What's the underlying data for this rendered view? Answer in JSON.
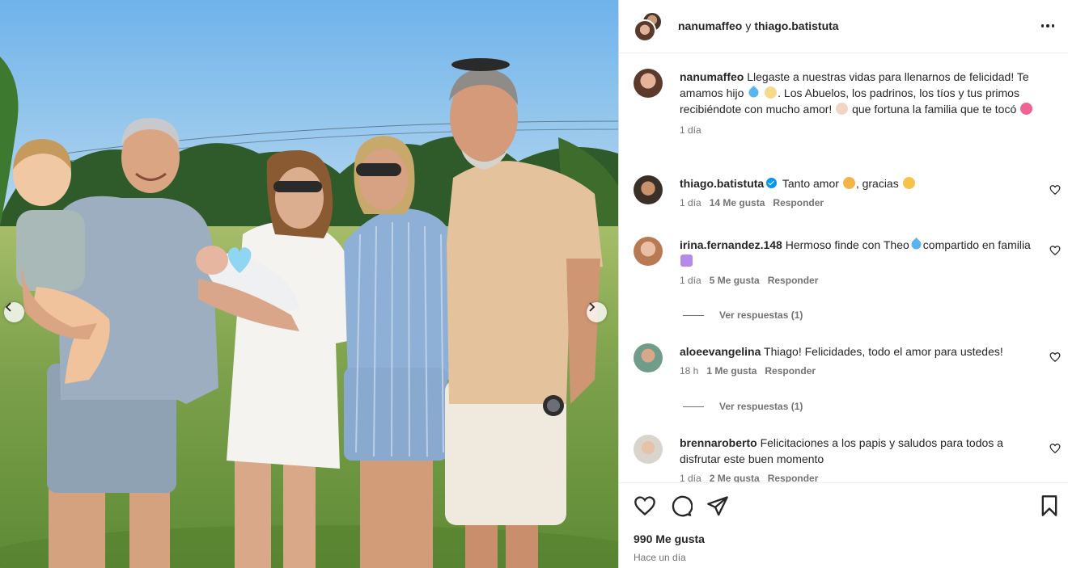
{
  "post": {
    "author": "nanumaffeo",
    "joiner": "y",
    "coauthor": "thiago.batistuta",
    "caption_user": "nanumaffeo",
    "caption_text_1": "Llegaste a nuestras vidas para llenarnos de felicidad! Te amamos hijo",
    "caption_text_2": ". Los Abuelos, los padrinos, los tíos y tus primos recibiéndote con mucho amor!",
    "caption_text_3": "que fortuna la familia que te tocó",
    "caption_time": "1 día",
    "likes": "990 Me gusta",
    "posted": "Hace un día"
  },
  "comments": [
    {
      "user": "thiago.batistuta",
      "text_1": "Tanto amor",
      "text_2": ", gracias",
      "time": "1 día",
      "likes": "14 Me gusta",
      "reply": "Responder"
    },
    {
      "user": "irina.fernandez.148",
      "text_1": "Hermoso finde con Theo",
      "text_2": "compartido en familia",
      "time": "1 día",
      "likes": "5 Me gusta",
      "reply": "Responder",
      "view_replies": "Ver respuestas (1)"
    },
    {
      "user": "aloeevangelina",
      "text_1": "Thiago! Felicidades, todo el amor para ustedes!",
      "time": "18 h",
      "likes": "1 Me gusta",
      "reply": "Responder",
      "view_replies": "Ver respuestas (1)"
    },
    {
      "user": "brennaroberto",
      "text_1": "Felicitaciones a los papis y saludos para todos a disfrutar este buen momento",
      "time": "1 día",
      "likes": "2 Me gusta",
      "reply": "Responder"
    }
  ],
  "icons": {
    "more": "more-options-icon",
    "like": "heart-icon",
    "comment": "comment-icon",
    "share": "share-icon",
    "save": "bookmark-icon",
    "prev": "chevron-left-icon",
    "next": "chevron-right-icon"
  },
  "colors": {
    "verified": "#0095f6",
    "text": "#262626",
    "secondary": "#737373"
  }
}
